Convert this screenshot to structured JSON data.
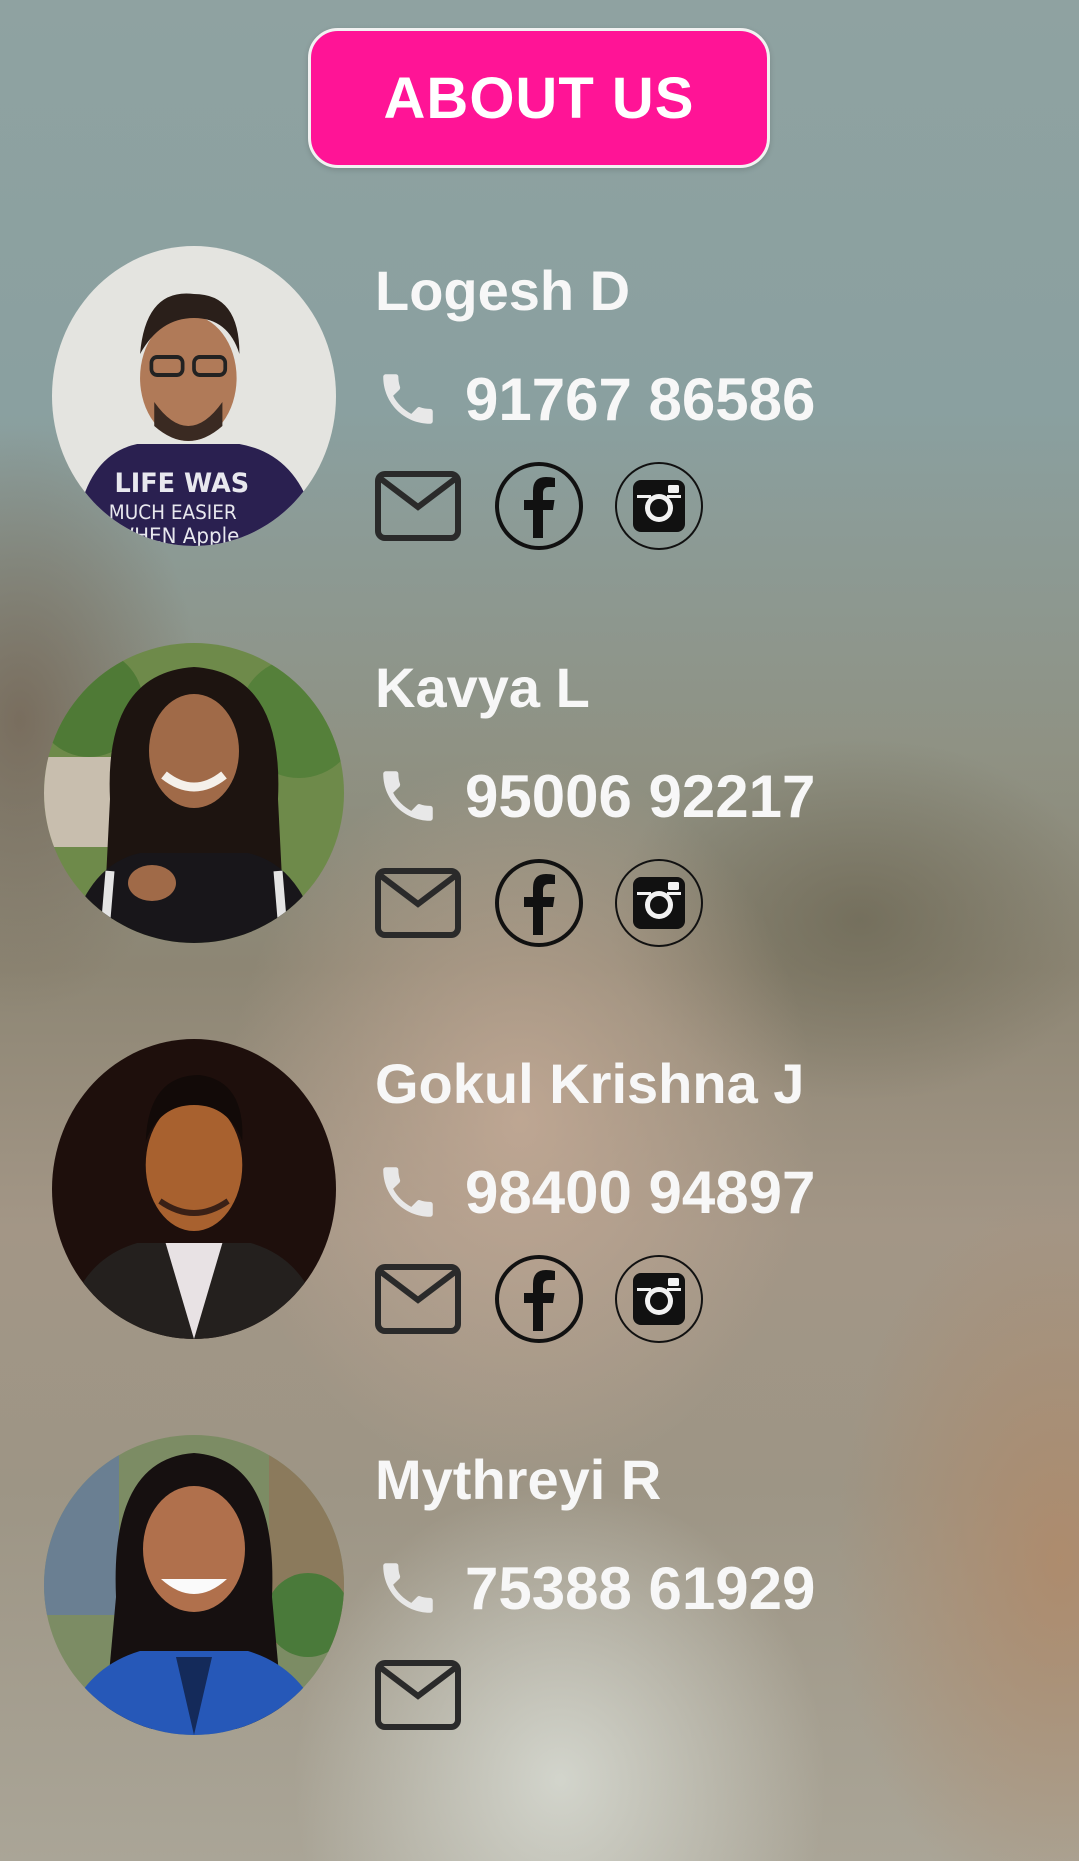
{
  "header": {
    "title": "ABOUT US"
  },
  "members": [
    {
      "name": "Logesh D",
      "phone": "91767 86586",
      "links": [
        "mail-icon",
        "facebook-icon",
        "instagram-icon"
      ]
    },
    {
      "name": "Kavya L",
      "phone": "95006 92217",
      "links": [
        "mail-icon",
        "facebook-icon",
        "instagram-icon"
      ]
    },
    {
      "name": "Gokul Krishna J",
      "phone": "98400 94897",
      "links": [
        "mail-icon",
        "facebook-icon",
        "instagram-icon"
      ]
    },
    {
      "name": "Mythreyi R",
      "phone": "75388 61929",
      "links": [
        "mail-icon"
      ]
    }
  ],
  "colors": {
    "accent": "#ff1496",
    "text": "#f7f7f7",
    "icon_light": "#e8e8e8",
    "icon_dark": "#2a2a2a"
  }
}
